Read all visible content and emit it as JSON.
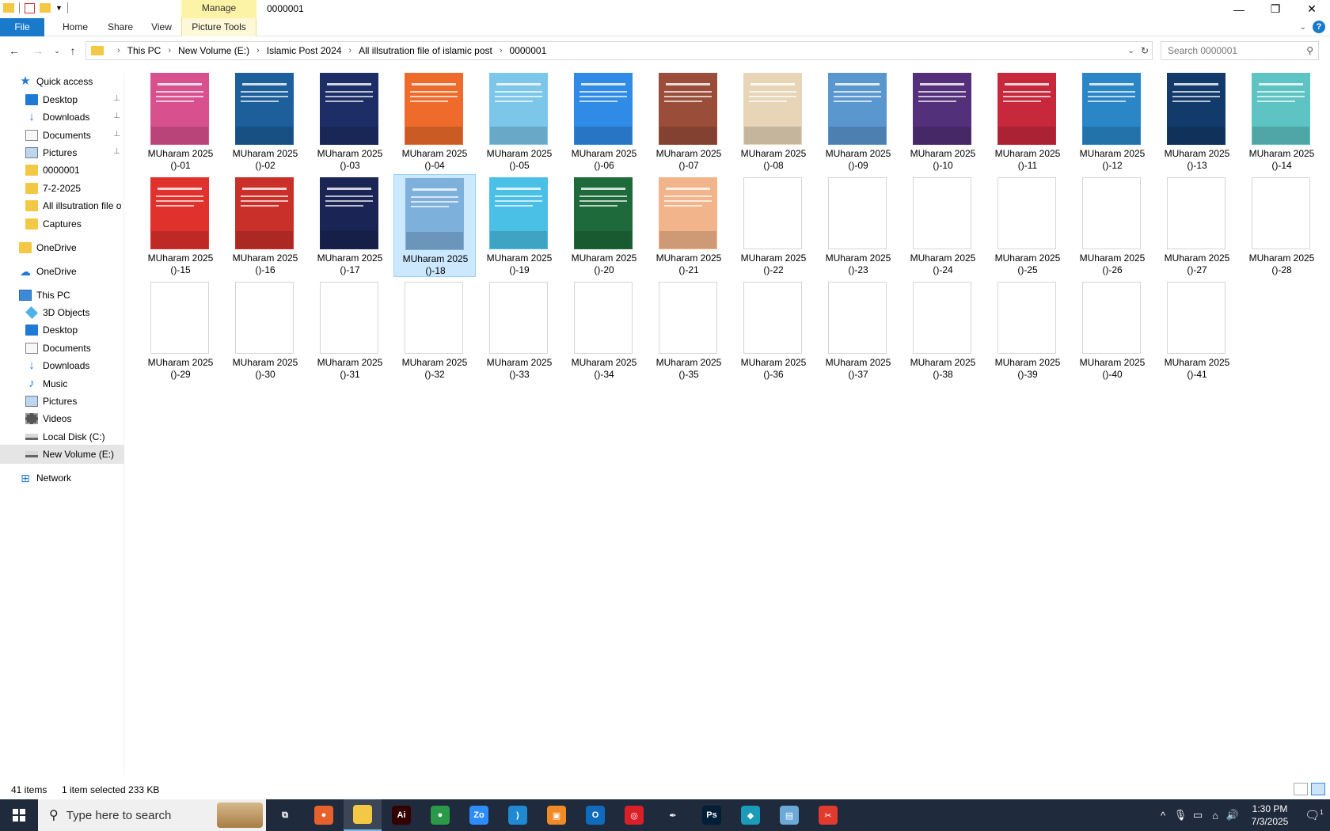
{
  "window": {
    "title": "0000001",
    "manage_tab": "Manage",
    "controls": {
      "minimize": "—",
      "maximize": "❐",
      "close": "✕"
    }
  },
  "ribbon": {
    "tabs": [
      {
        "label": "File"
      },
      {
        "label": "Home"
      },
      {
        "label": "Share"
      },
      {
        "label": "View"
      },
      {
        "label": "Picture Tools"
      }
    ],
    "help": "?"
  },
  "address": {
    "crumbs": [
      "This PC",
      "New Volume (E:)",
      "Islamic Post 2024",
      "All illsutration file of islamic post",
      "0000001"
    ],
    "search_placeholder": "Search 0000001"
  },
  "navpane": {
    "items": [
      {
        "label": "Quick access",
        "icon": "star-icon",
        "pinned": false
      },
      {
        "label": "Desktop",
        "icon": "desktop-icon",
        "pinned": true
      },
      {
        "label": "Downloads",
        "icon": "download-icon",
        "pinned": true
      },
      {
        "label": "Documents",
        "icon": "documents-icon",
        "pinned": true
      },
      {
        "label": "Pictures",
        "icon": "pictures-icon",
        "pinned": true
      },
      {
        "label": "0000001",
        "icon": "folder-icon",
        "pinned": false
      },
      {
        "label": "7-2-2025",
        "icon": "folder-icon",
        "pinned": false
      },
      {
        "label": "All illsutration file o",
        "icon": "folder-icon",
        "pinned": false
      },
      {
        "label": "Captures",
        "icon": "folder-icon",
        "pinned": false
      },
      {
        "label": "OneDrive",
        "icon": "onedrive-folder-icon",
        "pinned": false
      },
      {
        "label": "OneDrive",
        "icon": "cloud-icon",
        "pinned": false
      },
      {
        "label": "This PC",
        "icon": "computer-icon",
        "pinned": false
      },
      {
        "label": "3D Objects",
        "icon": "3d-objects-icon",
        "pinned": false
      },
      {
        "label": "Desktop",
        "icon": "desktop-icon",
        "pinned": false
      },
      {
        "label": "Documents",
        "icon": "documents-icon",
        "pinned": false
      },
      {
        "label": "Downloads",
        "icon": "download-icon",
        "pinned": false
      },
      {
        "label": "Music",
        "icon": "music-icon",
        "pinned": false
      },
      {
        "label": "Pictures",
        "icon": "pictures-icon",
        "pinned": false
      },
      {
        "label": "Videos",
        "icon": "videos-icon",
        "pinned": false
      },
      {
        "label": "Local Disk (C:)",
        "icon": "drive-icon",
        "pinned": false
      },
      {
        "label": "New Volume (E:)",
        "icon": "drive-icon",
        "pinned": false,
        "selected": true
      },
      {
        "label": "Network",
        "icon": "network-icon",
        "pinned": false
      }
    ],
    "pin_glyph": "📌"
  },
  "files": [
    {
      "line1": "MUharam 2025",
      "line2": "()-01",
      "color": "#d9508f"
    },
    {
      "line1": "MUharam 2025",
      "line2": "()-02",
      "color": "#1d5f9a"
    },
    {
      "line1": "MUharam 2025",
      "line2": "()-03",
      "color": "#1d2e66"
    },
    {
      "line1": "MUharam 2025",
      "line2": "()-04",
      "color": "#ef6b2c"
    },
    {
      "line1": "MUharam 2025",
      "line2": "()-05",
      "color": "#7cc6ea"
    },
    {
      "line1": "MUharam 2025",
      "line2": "()-06",
      "color": "#2f8be6"
    },
    {
      "line1": "MUharam 2025",
      "line2": "()-07",
      "color": "#9a4e3a"
    },
    {
      "line1": "MUharam 2025",
      "line2": "()-08",
      "color": "#e8d5b8"
    },
    {
      "line1": "MUharam 2025",
      "line2": "()-09",
      "color": "#5b97cf"
    },
    {
      "line1": "MUharam 2025",
      "line2": "()-10",
      "color": "#54307a"
    },
    {
      "line1": "MUharam 2025",
      "line2": "()-11",
      "color": "#c8283c"
    },
    {
      "line1": "MUharam 2025",
      "line2": "()-12",
      "color": "#2b86c8"
    },
    {
      "line1": "MUharam 2025",
      "line2": "()-13",
      "color": "#123a6a"
    },
    {
      "line1": "MUharam 2025",
      "line2": "()-14",
      "color": "#5ec3c3"
    },
    {
      "line1": "MUharam 2025",
      "line2": "()-15",
      "color": "#e0312c"
    },
    {
      "line1": "MUharam 2025",
      "line2": "()-16",
      "color": "#c9302a"
    },
    {
      "line1": "MUharam 2025",
      "line2": "()-17",
      "color": "#1a2555"
    },
    {
      "line1": "MUharam 2025",
      "line2": "()-18",
      "color": "#7eb0dc"
    },
    {
      "line1": "MUharam 2025",
      "line2": "()-19",
      "color": "#4bc0e6"
    },
    {
      "line1": "MUharam 2025",
      "line2": "()-20",
      "color": "#1e6a3a"
    },
    {
      "line1": "MUharam 2025",
      "line2": "()-21",
      "color": "#f2b48a"
    },
    {
      "line1": "MUharam 2025",
      "line2": "()-22",
      "color": ""
    },
    {
      "line1": "MUharam 2025",
      "line2": "()-23",
      "color": ""
    },
    {
      "line1": "MUharam 2025",
      "line2": "()-24",
      "color": ""
    },
    {
      "line1": "MUharam 2025",
      "line2": "()-25",
      "color": ""
    },
    {
      "line1": "MUharam 2025",
      "line2": "()-26",
      "color": ""
    },
    {
      "line1": "MUharam 2025",
      "line2": "()-27",
      "color": ""
    },
    {
      "line1": "MUharam 2025",
      "line2": "()-28",
      "color": ""
    },
    {
      "line1": "MUharam 2025",
      "line2": "()-29",
      "color": ""
    },
    {
      "line1": "MUharam 2025",
      "line2": "()-30",
      "color": ""
    },
    {
      "line1": "MUharam 2025",
      "line2": "()-31",
      "color": ""
    },
    {
      "line1": "MUharam 2025",
      "line2": "()-32",
      "color": ""
    },
    {
      "line1": "MUharam 2025",
      "line2": "()-33",
      "color": ""
    },
    {
      "line1": "MUharam 2025",
      "line2": "()-34",
      "color": ""
    },
    {
      "line1": "MUharam 2025",
      "line2": "()-35",
      "color": ""
    },
    {
      "line1": "MUharam 2025",
      "line2": "()-36",
      "color": ""
    },
    {
      "line1": "MUharam 2025",
      "line2": "()-37",
      "color": ""
    },
    {
      "line1": "MUharam 2025",
      "line2": "()-38",
      "color": ""
    },
    {
      "line1": "MUharam 2025",
      "line2": "()-39",
      "color": ""
    },
    {
      "line1": "MUharam 2025",
      "line2": "()-40",
      "color": ""
    },
    {
      "line1": "MUharam 2025",
      "line2": "()-41",
      "color": ""
    }
  ],
  "selected_file": "()-18",
  "status": {
    "count": "41 items",
    "selection": "1 item selected  233 KB"
  },
  "taskbar": {
    "search_placeholder": "Type here to search",
    "apps": [
      {
        "name": "task-view-icon",
        "glyph": "⧉",
        "color": "#1f2a3c"
      },
      {
        "name": "firefox-icon",
        "glyph": "●",
        "color": "#e8602c"
      },
      {
        "name": "file-explorer-icon",
        "glyph": "",
        "color": "#f3c845",
        "active": true
      },
      {
        "name": "illustrator-icon",
        "glyph": "Ai",
        "color": "#330000"
      },
      {
        "name": "chrome-icon",
        "glyph": "●",
        "color": "#2a9a48"
      },
      {
        "name": "zoom-icon",
        "glyph": "Zo",
        "color": "#2d8cff"
      },
      {
        "name": "vscode-icon",
        "glyph": "⟩",
        "color": "#1f8ad2"
      },
      {
        "name": "app-icon-orange",
        "glyph": "▣",
        "color": "#f08a24"
      },
      {
        "name": "outlook-icon",
        "glyph": "O",
        "color": "#0f6cbd"
      },
      {
        "name": "creative-cloud-icon",
        "glyph": "◎",
        "color": "#da1f26"
      },
      {
        "name": "pen-tool-icon",
        "glyph": "✒",
        "color": "#1f2a3c"
      },
      {
        "name": "photoshop-icon",
        "glyph": "Ps",
        "color": "#001e36"
      },
      {
        "name": "app-icon-teal",
        "glyph": "◆",
        "color": "#1a9bb8"
      },
      {
        "name": "notepad-icon",
        "glyph": "▤",
        "color": "#6aa9d8"
      },
      {
        "name": "snipping-tool-icon",
        "glyph": "✂",
        "color": "#e03b2d"
      }
    ],
    "tray": {
      "chevron": "^",
      "mic": "🎙",
      "wifi": "⌂",
      "speaker": "🔊",
      "time": "1:30 PM",
      "date": "7/3/2025",
      "notification": "1"
    }
  }
}
